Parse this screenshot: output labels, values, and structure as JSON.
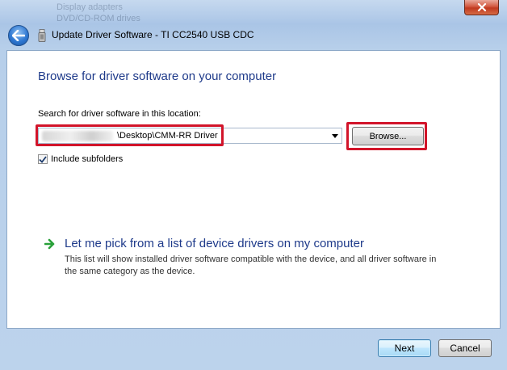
{
  "window": {
    "title": "Update Driver Software - TI CC2540 USB CDC",
    "background_text": [
      "Display adapters",
      "DVD/CD-ROM drives"
    ]
  },
  "content": {
    "heading": "Browse for driver software on your computer",
    "search_label": "Search for driver software in this location:",
    "path_value": "\\Desktop\\CMM-RR Driver",
    "browse_label": "Browse...",
    "include_subfolders_label": "Include subfolders",
    "include_subfolders_checked": true,
    "pick_link": "Let me pick from a list of device drivers on my computer",
    "pick_description": "This list will show installed driver software compatible with the device, and all driver software in the same category as the device."
  },
  "footer": {
    "next_label": "Next",
    "cancel_label": "Cancel"
  },
  "colors": {
    "heading_blue": "#1e3a8a",
    "highlight_red": "#d2142a",
    "arrow_green": "#2aa13a"
  },
  "icons": {
    "back": "back-arrow-icon",
    "close": "close-icon",
    "device": "usb-device-icon",
    "pick": "green-arrow-icon"
  }
}
